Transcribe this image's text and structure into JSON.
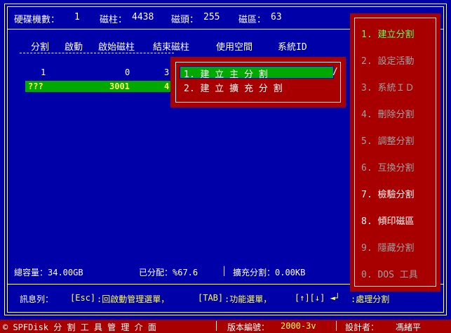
{
  "header": {
    "disk_label": "硬碟機數：",
    "disk_value": "1",
    "cyl_label": "磁柱：",
    "cyl_value": "4438",
    "head_label": "磁頭：",
    "head_value": "255",
    "sector_label": "磁區：",
    "sector_value": "63"
  },
  "table": {
    "columns": [
      "分割",
      "啟動",
      "啟始磁柱",
      "結束磁柱",
      "使用空間",
      "系統ID"
    ],
    "rows": [
      {
        "part": "1",
        "boot": "",
        "start": "0",
        "end": "3"
      },
      {
        "part": "???",
        "boot": "",
        "start": "3001",
        "end": "4"
      }
    ]
  },
  "popup": {
    "items": [
      {
        "label": "1.  建 立 主 分 割",
        "suffix": "/"
      },
      {
        "label": "2.  建 立 擴 充 分 割",
        "suffix": ""
      }
    ]
  },
  "menu": {
    "items": [
      {
        "label": "1. 建立分割",
        "state": "active"
      },
      {
        "label": "2. 設定活動",
        "state": "disabled"
      },
      {
        "label": "3. 系統ＩＤ",
        "state": "disabled"
      },
      {
        "label": "4. 刪除分割",
        "state": "disabled"
      },
      {
        "label": "5. 調整分割",
        "state": "disabled"
      },
      {
        "label": "6. 互換分割",
        "state": "disabled"
      },
      {
        "label": "7. 檢驗分割",
        "state": "enabled"
      },
      {
        "label": "8. 傾印磁區",
        "state": "enabled"
      },
      {
        "label": "9. 隱藏分割",
        "state": "disabled"
      },
      {
        "label": "0. DOS 工具",
        "state": "disabled"
      }
    ]
  },
  "summary": {
    "capacity": "總容量：34.00GB",
    "allocated": "已分配：%67.6",
    "extended": "擴充分割：0.00KB"
  },
  "status": {
    "label": "訊息列：",
    "text1": "[Esc]",
    "text2": ":回啟動管理選單，",
    "text3": "[TAB]",
    "text4": ":功能選單，",
    "text5": "[↑][↓] ◄┘",
    "text6": ":處理分割"
  },
  "footer": {
    "app": "© SPFDisk 分 割 工 具 管 理 介 面",
    "version_label": "版本編號：",
    "version_value": "2000-3v",
    "designer_label": "設計者：",
    "designer_value": "馮緒平"
  },
  "colors": {
    "background": "#0000a8",
    "panel_red": "#a80000",
    "highlight_green": "#00a800",
    "active_text": "#55ff55",
    "disabled_text": "#a0a0a0",
    "accent_yellow": "#ffff55"
  }
}
